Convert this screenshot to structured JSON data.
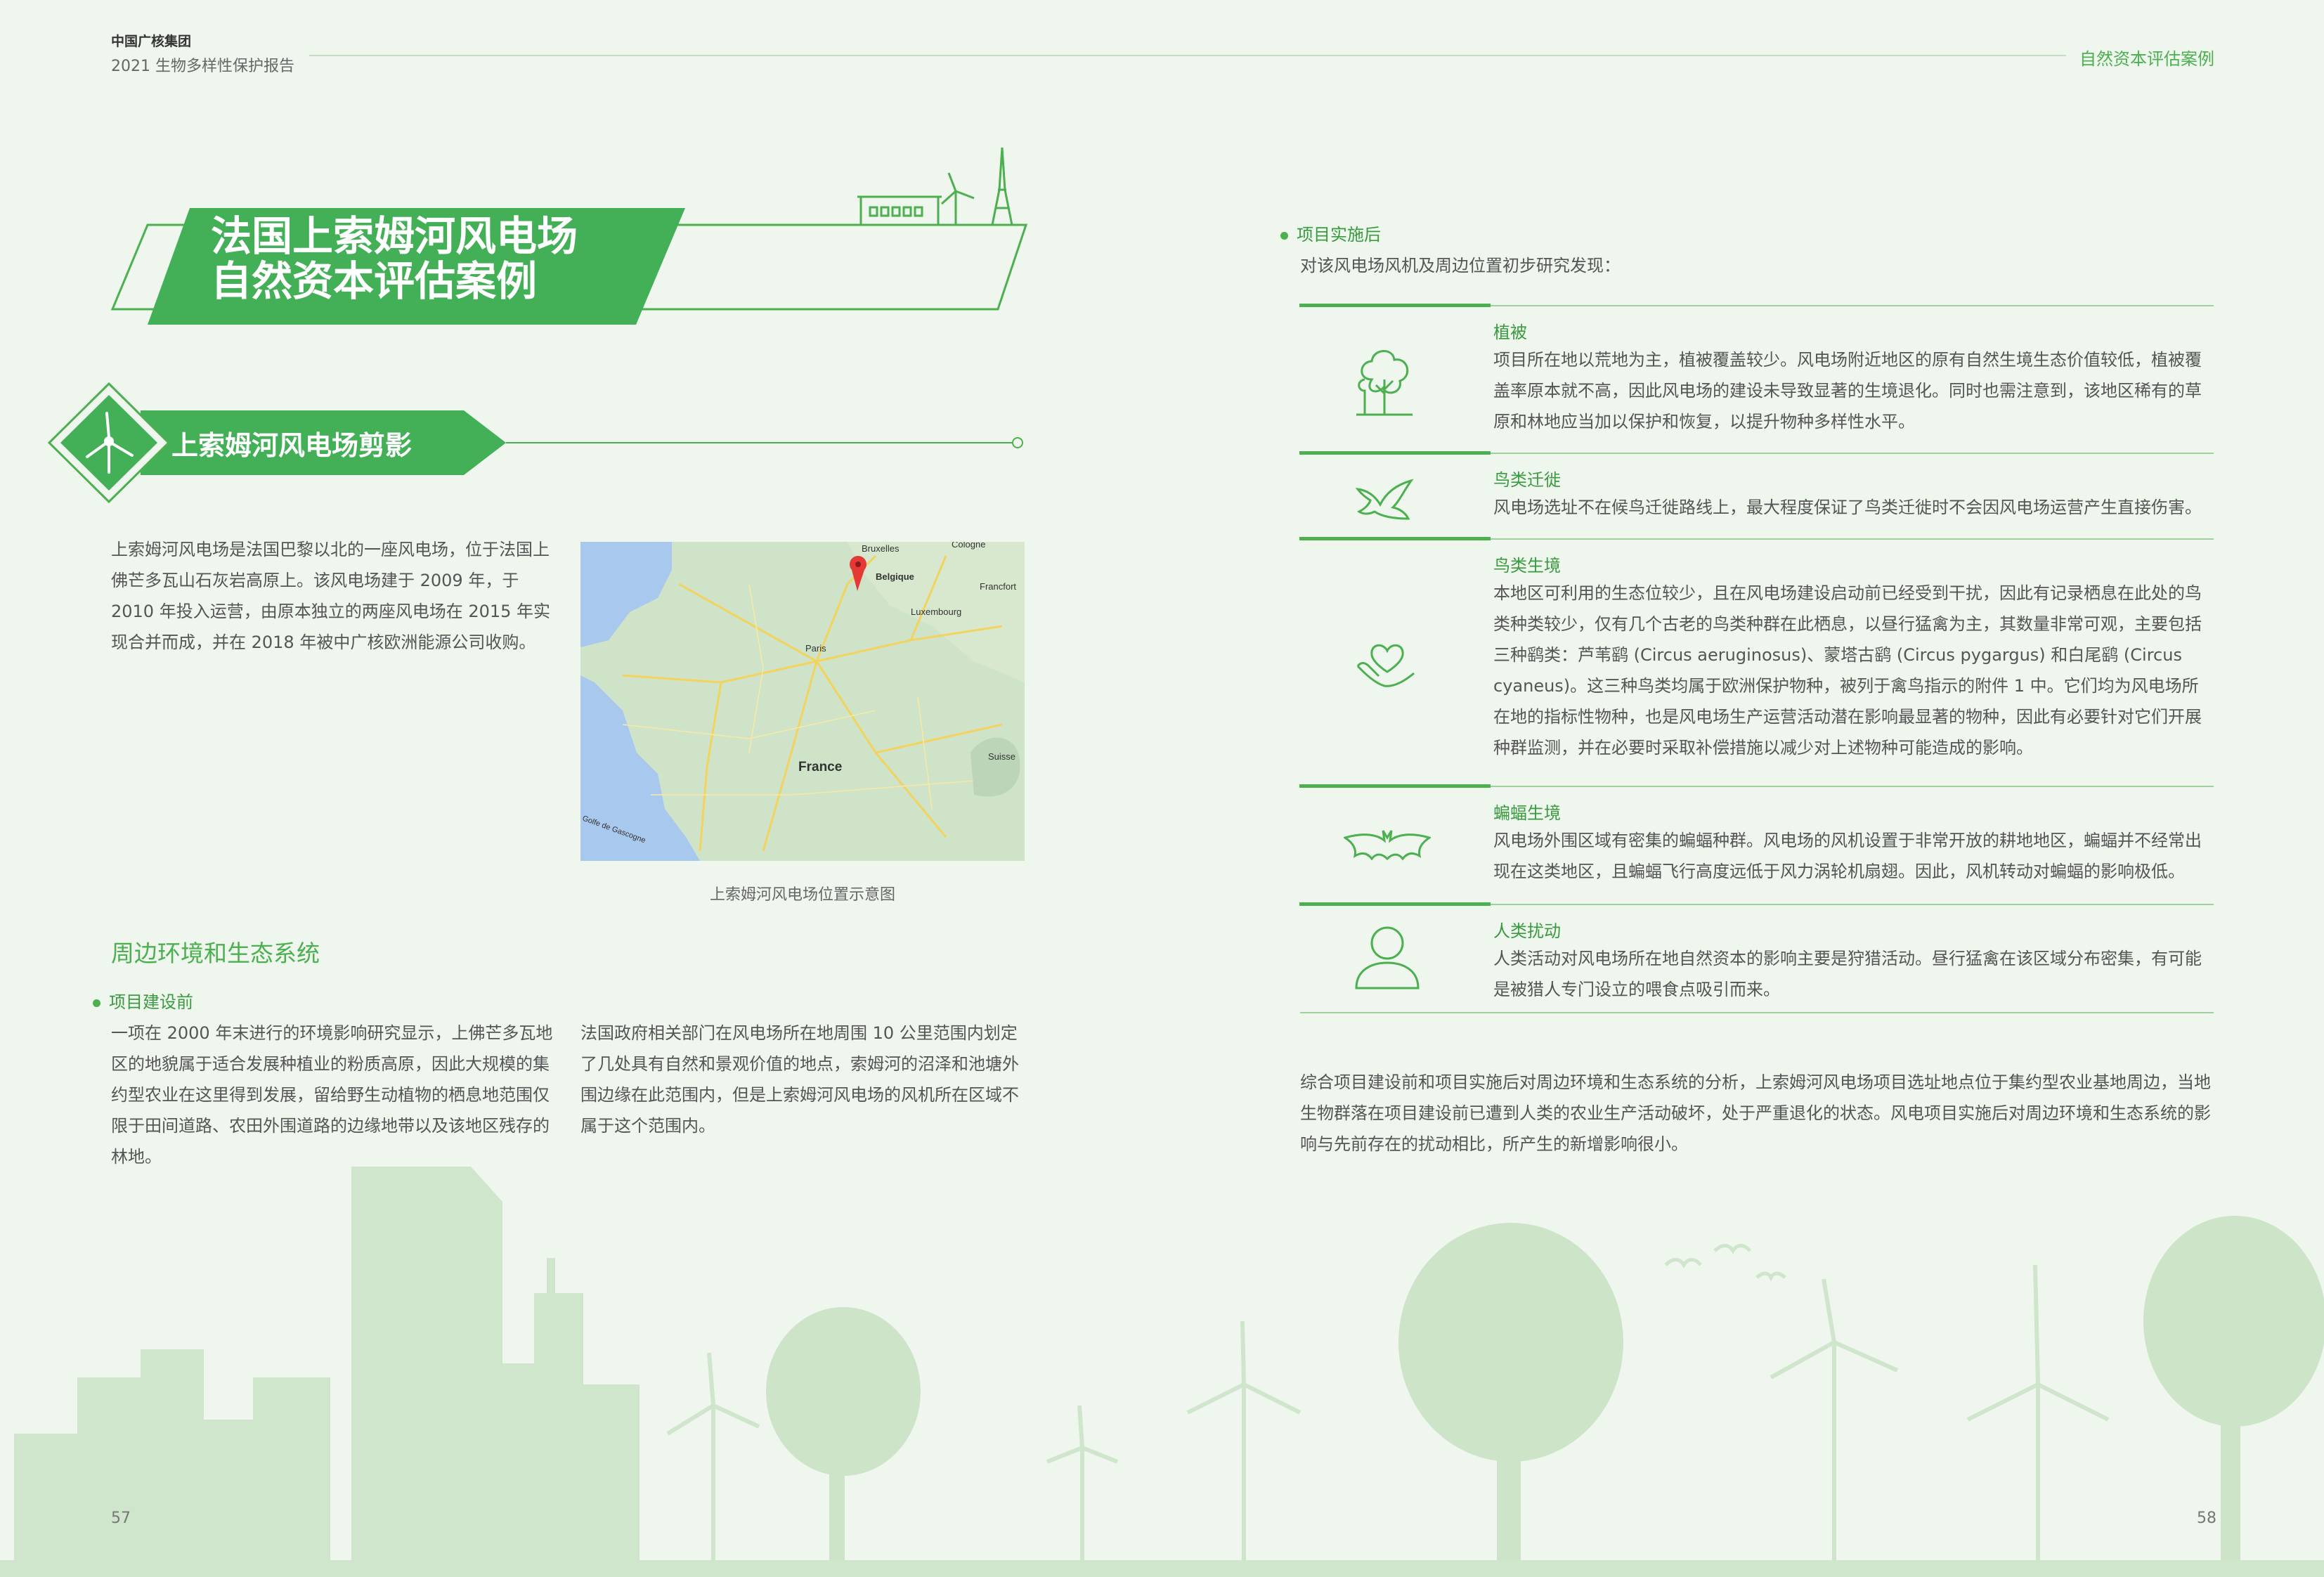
{
  "header": {
    "company": "中国广核集团",
    "report": "2021 生物多样性保护报告",
    "section": "自然资本评估案例"
  },
  "title": {
    "line1": "法国上索姆河风电场",
    "line2": "自然资本评估案例"
  },
  "section_profile": {
    "title": "上索姆河风电场剪影",
    "intro": "上索姆河风电场是法国巴黎以北的一座风电场，位于法国上佛芒多瓦山石灰岩高原上。该风电场建于 2009 年，于 2010 年投入运营，由原本独立的两座风电场在 2015 年实现合并而成，并在 2018 年被中广核欧洲能源公司收购。"
  },
  "map": {
    "caption": "上索姆河风电场位置示意图",
    "labels": {
      "bruxelles": "Bruxelles",
      "cologne": "Cologne",
      "belgique": "Belgique",
      "francfort": "Francfort",
      "luxembourg": "Luxembourg",
      "paris": "Paris",
      "france": "France",
      "suisse": "Suisse",
      "golfe": "Golfe de Gascogne"
    },
    "colors": {
      "sea": "#a9c8ee",
      "land": "#cfe3c8",
      "roads": "#f2d35e",
      "marker": "#e53935"
    }
  },
  "environment": {
    "heading": "周边环境和生态系统",
    "before_label": "项目建设前",
    "before_col1": "一项在 2000 年末进行的环境影响研究显示，上佛芒多瓦地区的地貌属于适合发展种植业的粉质高原，因此大规模的集约型农业在这里得到发展，留给野生动植物的栖息地范围仅限于田间道路、农田外围道路的边缘地带以及该地区残存的林地。",
    "before_col2": "法国政府相关部门在风电场所在地周围 10 公里范围内划定了几处具有自然和景观价值的地点，索姆河的沼泽和池塘外围边缘在此范围内，但是上索姆河风电场的风机所在区域不属于这个范围内。",
    "after_label": "项目实施后",
    "after_intro": "对该风电场风机及周边位置初步研究发现："
  },
  "findings": [
    {
      "title": "植被",
      "icon": "tree-icon",
      "text": "项目所在地以荒地为主，植被覆盖较少。风电场附近地区的原有自然生境生态价值较低，植被覆盖率原本就不高，因此风电场的建设未导致显著的生境退化。同时也需注意到，该地区稀有的草原和林地应当加以保护和恢复，以提升物种多样性水平。"
    },
    {
      "title": "鸟类迁徙",
      "icon": "bird-icon",
      "text": "风电场选址不在候鸟迁徙路线上，最大程度保证了鸟类迁徙时不会因风电场运营产生直接伤害。"
    },
    {
      "title": "鸟类生境",
      "icon": "hand-heart-icon",
      "text": "本地区可利用的生态位较少，且在风电场建设启动前已经受到干扰，因此有记录栖息在此处的鸟类种类较少，仅有几个古老的鸟类种群在此栖息，以昼行猛禽为主，其数量非常可观，主要包括三种鹞类：芦苇鹞 (Circus aeruginosus)、蒙塔古鹞 (Circus pygargus) 和白尾鹞 (Circus cyaneus)。这三种鸟类均属于欧洲保护物种，被列于禽鸟指示的附件 1 中。它们均为风电场所在地的指标性物种，也是风电场生产运营活动潜在影响最显著的物种，因此有必要针对它们开展种群监测，并在必要时采取补偿措施以减少对上述物种可能造成的影响。"
    },
    {
      "title": "蝙蝠生境",
      "icon": "bat-icon",
      "text": "风电场外围区域有密集的蝙蝠种群。风电场的风机设置于非常开放的耕地地区，蝙蝠并不经常出现在这类地区，且蝙蝠飞行高度远低于风力涡轮机扇翅。因此，风机转动对蝙蝠的影响极低。"
    },
    {
      "title": "人类扰动",
      "icon": "person-icon",
      "text": "人类活动对风电场所在地自然资本的影响主要是狩猎活动。昼行猛禽在该区域分布密集，有可能是被猎人专门设立的喂食点吸引而来。"
    }
  ],
  "summary": "综合项目建设前和项目实施后对周边环境和生态系统的分析，上索姆河风电场项目选址地点位于集约型农业基地周边，当地生物群落在项目建设前已遭到人类的农业生产活动破坏，处于严重退化的状态。风电项目实施后对周边环境和生态系统的影响与先前存在的扰动相比，所产生的新增影响很小。",
  "pages": {
    "left": "57",
    "right": "58"
  },
  "colors": {
    "accent": "#4caf50",
    "background": "#eef6ee"
  }
}
